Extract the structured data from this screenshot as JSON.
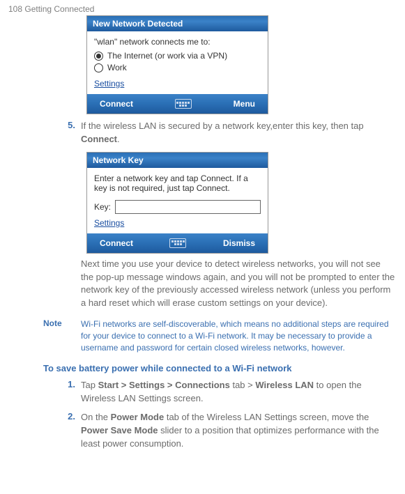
{
  "header": {
    "page_label": "108  Getting Connected"
  },
  "dialog1": {
    "title": "New Network Detected",
    "body_line": "\"wlan\" network connects me to:",
    "option1": "The Internet (or work via a VPN)",
    "option2": "Work",
    "settings": "Settings",
    "left_btn": "Connect",
    "right_btn": "Menu"
  },
  "step5": {
    "num": "5.",
    "text_before": "If the wireless LAN is secured by a network key,enter this key, then tap ",
    "bold": "Connect",
    "text_after": "."
  },
  "dialog2": {
    "title": "Network Key",
    "body_text": "Enter a network key and tap Connect. If a key is not required, just tap Connect.",
    "key_label": "Key:",
    "settings": "Settings",
    "left_btn": "Connect",
    "right_btn": "Dismiss"
  },
  "para_next": "Next time you use your device to detect wireless networks, you will not see the pop-up message windows again, and you will not be prompted to enter the network key of the previously accessed wireless network (unless you perform a hard reset which will erase custom settings on your device).",
  "note": {
    "label": "Note",
    "text": "Wi-Fi networks are self-discoverable, which means no additional steps are required for your device to connect to a Wi-Fi network. It may be necessary to provide a username and password for certain closed wireless networks, however."
  },
  "heading2": "To save battery power while connected to a Wi-Fi network",
  "step1b": {
    "num": "1.",
    "p1": "Tap ",
    "b1": "Start > Settings > Connections",
    "p2": " tab > ",
    "b2": "Wireless LAN",
    "p3": " to open the Wireless LAN Settings screen."
  },
  "step2b": {
    "num": "2.",
    "p1": "On the ",
    "b1": "Power Mode",
    "p2": " tab of the Wireless LAN Settings screen, move the ",
    "b2": "Power Save Mode",
    "p3": " slider to a position that optimizes performance with the least power consumption."
  }
}
